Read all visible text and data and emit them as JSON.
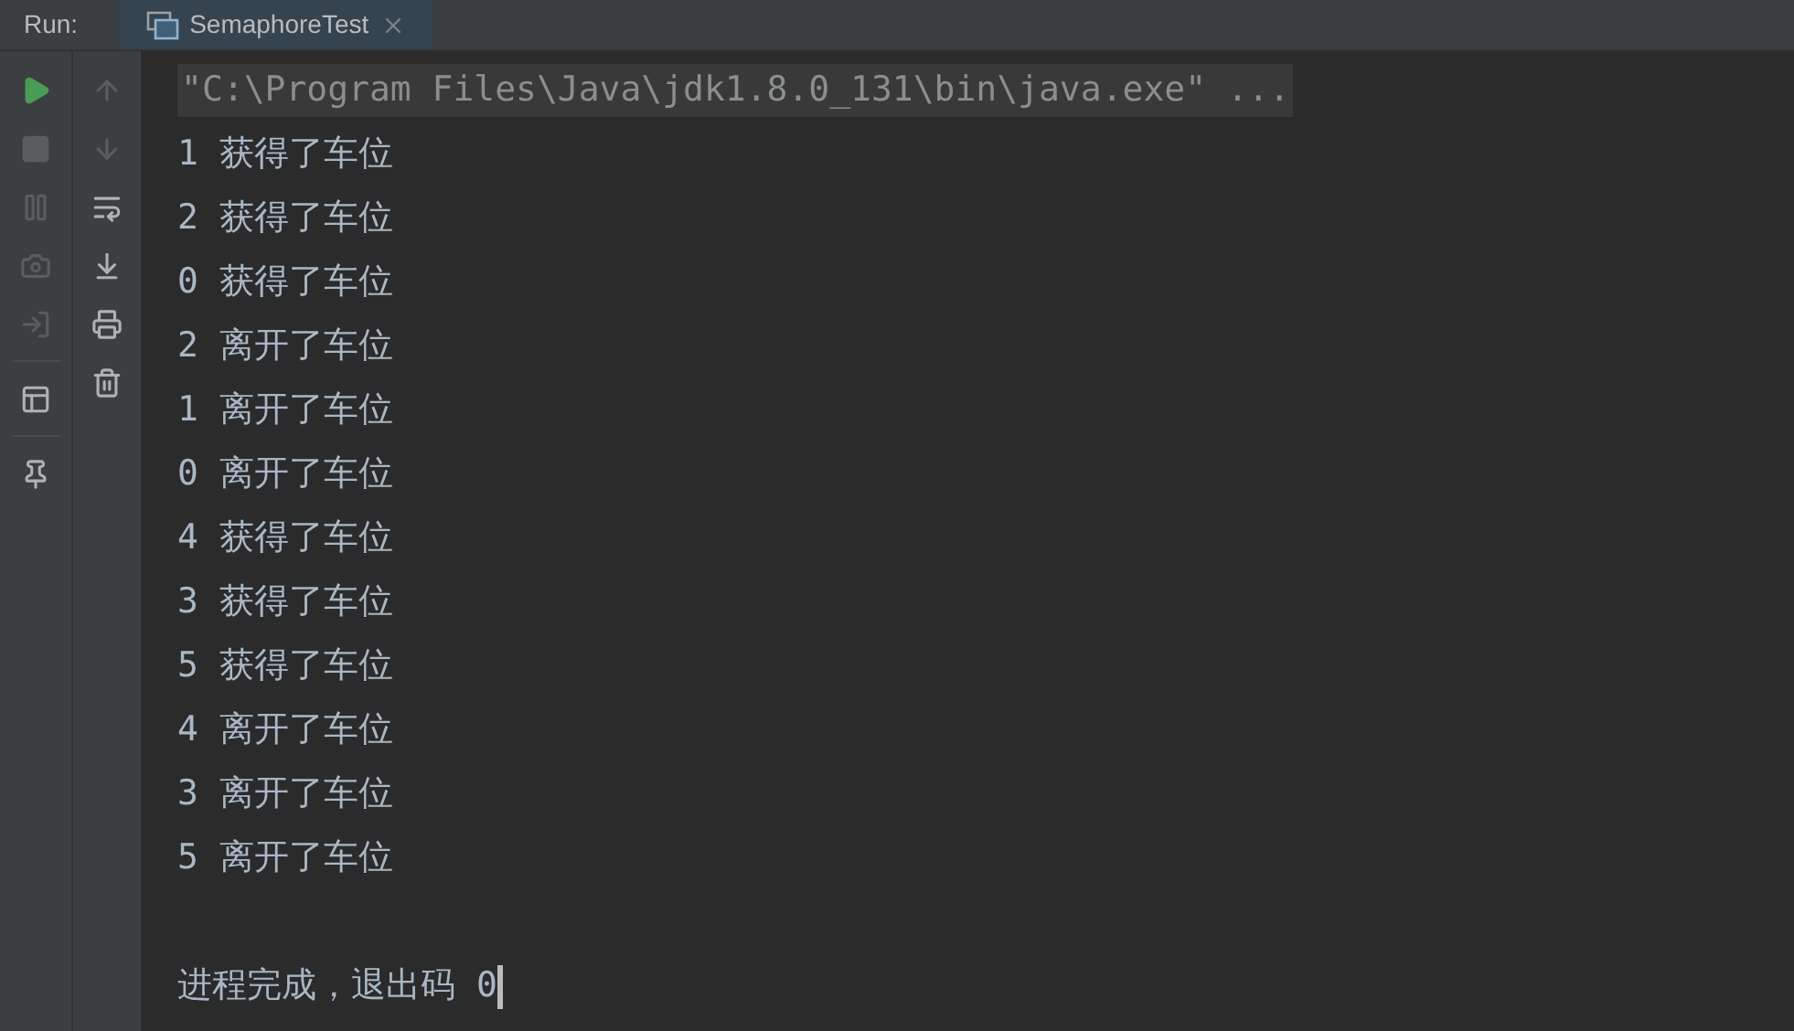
{
  "run_label": "Run:",
  "tabs": [
    {
      "label": "SemaphoreTest",
      "selected": true
    }
  ],
  "left_toolbar": [
    {
      "kind": "run",
      "disabled": false
    },
    {
      "kind": "stop",
      "disabled": true
    },
    {
      "kind": "pause",
      "disabled": true
    },
    {
      "kind": "dump",
      "disabled": true
    },
    {
      "kind": "exit",
      "disabled": true
    },
    {
      "kind": "separator"
    },
    {
      "kind": "layout",
      "disabled": false
    },
    {
      "kind": "separator"
    },
    {
      "kind": "pin",
      "disabled": false
    }
  ],
  "right_toolbar": [
    {
      "kind": "up",
      "disabled": true
    },
    {
      "kind": "down",
      "disabled": true
    },
    {
      "kind": "wrap",
      "disabled": false
    },
    {
      "kind": "scroll_end",
      "disabled": false
    },
    {
      "kind": "print",
      "disabled": false
    },
    {
      "kind": "clear",
      "disabled": false
    }
  ],
  "console": [
    {
      "kind": "command",
      "text": "\"C:\\Program Files\\Java\\jdk1.8.0_131\\bin\\java.exe\" ..."
    },
    {
      "kind": "output",
      "text": "1 获得了车位"
    },
    {
      "kind": "output",
      "text": "2 获得了车位"
    },
    {
      "kind": "output",
      "text": "0 获得了车位"
    },
    {
      "kind": "output",
      "text": "2 离开了车位"
    },
    {
      "kind": "output",
      "text": "1 离开了车位"
    },
    {
      "kind": "output",
      "text": "0 离开了车位"
    },
    {
      "kind": "output",
      "text": "4 获得了车位"
    },
    {
      "kind": "output",
      "text": "3 获得了车位"
    },
    {
      "kind": "output",
      "text": "5 获得了车位"
    },
    {
      "kind": "output",
      "text": "4 离开了车位"
    },
    {
      "kind": "output",
      "text": "3 离开了车位"
    },
    {
      "kind": "output",
      "text": "5 离开了车位"
    },
    {
      "kind": "blank"
    },
    {
      "kind": "output",
      "text": "进程完成，退出码 0",
      "cursor": true
    }
  ]
}
